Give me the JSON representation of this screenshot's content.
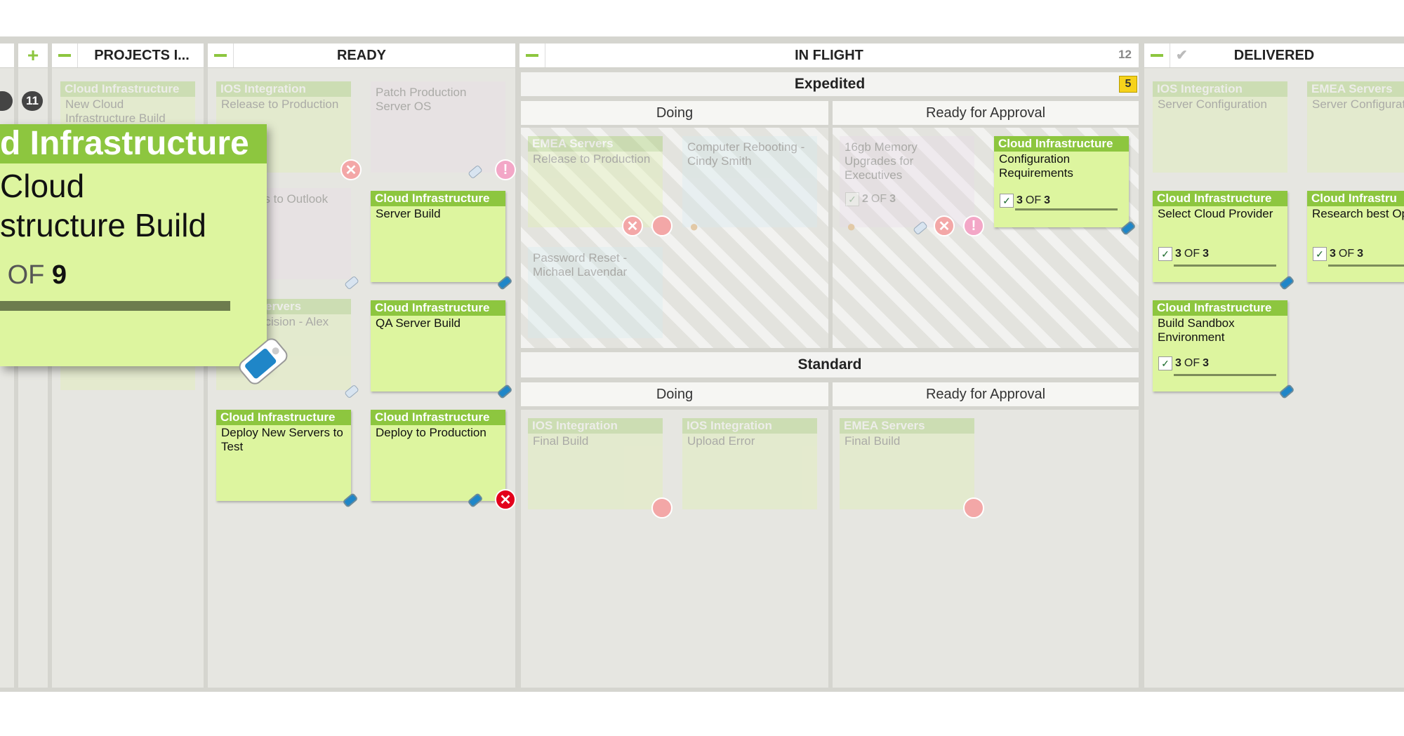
{
  "left_controls": {
    "add_symbol": "+",
    "bubble_count": "11"
  },
  "columns": {
    "projects": {
      "title": "PROJECTS I..."
    },
    "ready": {
      "title": "READY"
    },
    "inflight": {
      "title": "IN FLIGHT",
      "count": "12"
    },
    "delivered": {
      "title": "DELIVERED"
    }
  },
  "lanes": {
    "expedited": {
      "title": "Expedited",
      "wip": "5"
    },
    "standard": {
      "title": "Standard"
    },
    "doing": "Doing",
    "ready_for_approval": "Ready for Approval"
  },
  "zoom_card": {
    "title": "d Infrastructure",
    "line1": "Cloud",
    "line2": "structure Build",
    "progress_prefix": "OF",
    "progress_total": "9"
  },
  "cards": {
    "proj1": {
      "title": "Cloud Infrastructure",
      "text": "New Cloud Infrastructure Build"
    },
    "r_ios": {
      "title": "IOS Integration",
      "text": "Release to Production"
    },
    "r_patch": {
      "text": "Patch Production Server OS"
    },
    "r_email": {
      "text": "e Email s to Outlook"
    },
    "r_server_build": {
      "title": "Cloud Infrastructure",
      "text": "Server Build"
    },
    "r_servers": {
      "title": "ervers",
      "text": "ecision - Alex"
    },
    "r_qa": {
      "title": "Cloud Infrastructure",
      "text": "QA Server Build"
    },
    "r_deploy_test": {
      "title": "Cloud Infrastructure",
      "text": "Deploy New Servers to Test"
    },
    "r_deploy_prod": {
      "title": "Cloud Infrastructure",
      "text": "Deploy to Production"
    },
    "e_emea": {
      "title": "EMEA Servers",
      "text": "Release to Production"
    },
    "e_computer": {
      "text": "Computer Rebooting - Cindy Smith"
    },
    "e_password": {
      "text": "Password Reset - Michael Lavendar"
    },
    "e_memory": {
      "text": "16gb Memory Upgrades for Executives",
      "done": "2",
      "of": "OF",
      "total": "3"
    },
    "e_config": {
      "title": "Cloud Infrastructure",
      "text": "Configuration Requirements",
      "done": "3",
      "of": "OF",
      "total": "3"
    },
    "s_ios_final": {
      "title": "IOS Integration",
      "text": "Final Build"
    },
    "s_ios_upload": {
      "title": "IOS Integration",
      "text": "Upload Error"
    },
    "s_emea_final": {
      "title": "EMEA Servers",
      "text": "Final Build"
    },
    "d_ios": {
      "title": "IOS Integration",
      "text": "Server Configuration"
    },
    "d_emea": {
      "title": "EMEA Servers",
      "text": "Server Configuration"
    },
    "d_select": {
      "title": "Cloud Infrastructure",
      "text": "Select Cloud Provider",
      "done": "3",
      "of": "OF",
      "total": "3"
    },
    "d_research": {
      "title": "Cloud Infrastru",
      "text": "Research best Options",
      "done": "3",
      "of": "OF",
      "total": "3"
    },
    "d_sandbox": {
      "title": "Cloud Infrastructure",
      "text": "Build Sandbox Environment",
      "done": "3",
      "of": "OF",
      "total": "3"
    }
  },
  "colors": {
    "accent": "#8dc63f",
    "card": "#ddf59f",
    "blocker": "#e3001b",
    "wip_badge": "#f6d21b"
  }
}
